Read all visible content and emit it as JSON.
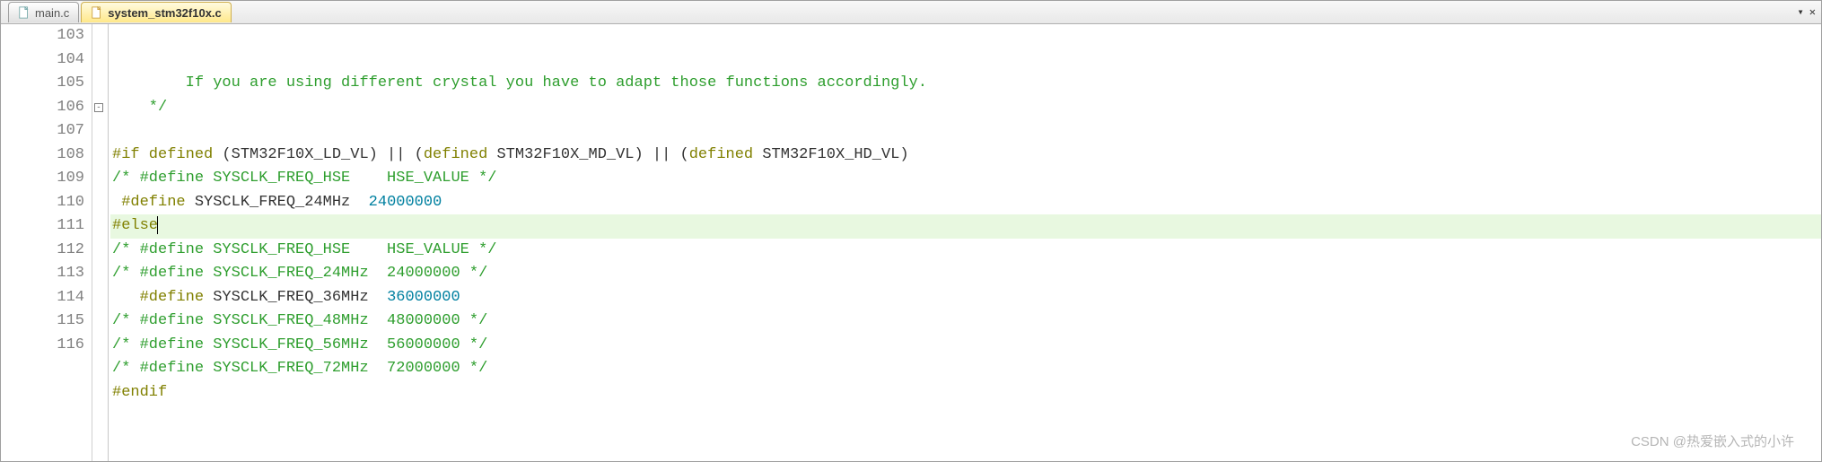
{
  "tabs": [
    {
      "label": "main.c",
      "active": false
    },
    {
      "label": "system_stm32f10x.c",
      "active": true
    }
  ],
  "tab_controls": {
    "dropdown": "▾",
    "close": "✕"
  },
  "lines": [
    {
      "num": "103",
      "fold": "",
      "highlight": false,
      "segments": [
        {
          "cls": "comment",
          "text": "        If you are using different crystal you have to adapt those functions accordingly."
        }
      ]
    },
    {
      "num": "104",
      "fold": "",
      "highlight": false,
      "segments": [
        {
          "cls": "comment",
          "text": "    */"
        }
      ]
    },
    {
      "num": "105",
      "fold": "",
      "highlight": false,
      "segments": [
        {
          "cls": "plain",
          "text": ""
        }
      ]
    },
    {
      "num": "106",
      "fold": "⊟",
      "highlight": false,
      "segments": [
        {
          "cls": "preproc",
          "text": "#if defined "
        },
        {
          "cls": "plain",
          "text": "(STM32F10X_LD_VL) || ("
        },
        {
          "cls": "preproc",
          "text": "defined"
        },
        {
          "cls": "plain",
          "text": " STM32F10X_MD_VL) || ("
        },
        {
          "cls": "preproc",
          "text": "defined"
        },
        {
          "cls": "plain",
          "text": " STM32F10X_HD_VL)"
        }
      ]
    },
    {
      "num": "107",
      "fold": "",
      "highlight": false,
      "segments": [
        {
          "cls": "comment",
          "text": "/* #define SYSCLK_FREQ_HSE    HSE_VALUE */"
        }
      ]
    },
    {
      "num": "108",
      "fold": "",
      "highlight": false,
      "segments": [
        {
          "cls": "preproc",
          "text": " #define "
        },
        {
          "cls": "plain",
          "text": "SYSCLK_FREQ_24MHz  "
        },
        {
          "cls": "number",
          "text": "24000000"
        }
      ]
    },
    {
      "num": "109",
      "fold": "",
      "highlight": true,
      "segments": [
        {
          "cls": "preproc",
          "text": "#else"
        }
      ],
      "cursor_after": true
    },
    {
      "num": "110",
      "fold": "",
      "highlight": false,
      "segments": [
        {
          "cls": "comment",
          "text": "/* #define SYSCLK_FREQ_HSE    HSE_VALUE */"
        }
      ]
    },
    {
      "num": "111",
      "fold": "",
      "highlight": false,
      "segments": [
        {
          "cls": "comment",
          "text": "/* #define SYSCLK_FREQ_24MHz  24000000 */ "
        }
      ]
    },
    {
      "num": "112",
      "fold": "",
      "highlight": false,
      "segments": [
        {
          "cls": "preproc",
          "text": "   #define "
        },
        {
          "cls": "plain",
          "text": "SYSCLK_FREQ_36MHz  "
        },
        {
          "cls": "number",
          "text": "36000000"
        }
      ]
    },
    {
      "num": "113",
      "fold": "",
      "highlight": false,
      "segments": [
        {
          "cls": "comment",
          "text": "/* #define SYSCLK_FREQ_48MHz  48000000 */"
        }
      ]
    },
    {
      "num": "114",
      "fold": "",
      "highlight": false,
      "segments": [
        {
          "cls": "comment",
          "text": "/* #define SYSCLK_FREQ_56MHz  56000000 */"
        }
      ]
    },
    {
      "num": "115",
      "fold": "",
      "highlight": false,
      "segments": [
        {
          "cls": "comment",
          "text": "/* #define SYSCLK_FREQ_72MHz  72000000 */"
        }
      ]
    },
    {
      "num": "116",
      "fold": "",
      "highlight": false,
      "segments": [
        {
          "cls": "preproc",
          "text": "#endif"
        }
      ]
    }
  ],
  "watermark": "CSDN @热爱嵌入式的小许"
}
